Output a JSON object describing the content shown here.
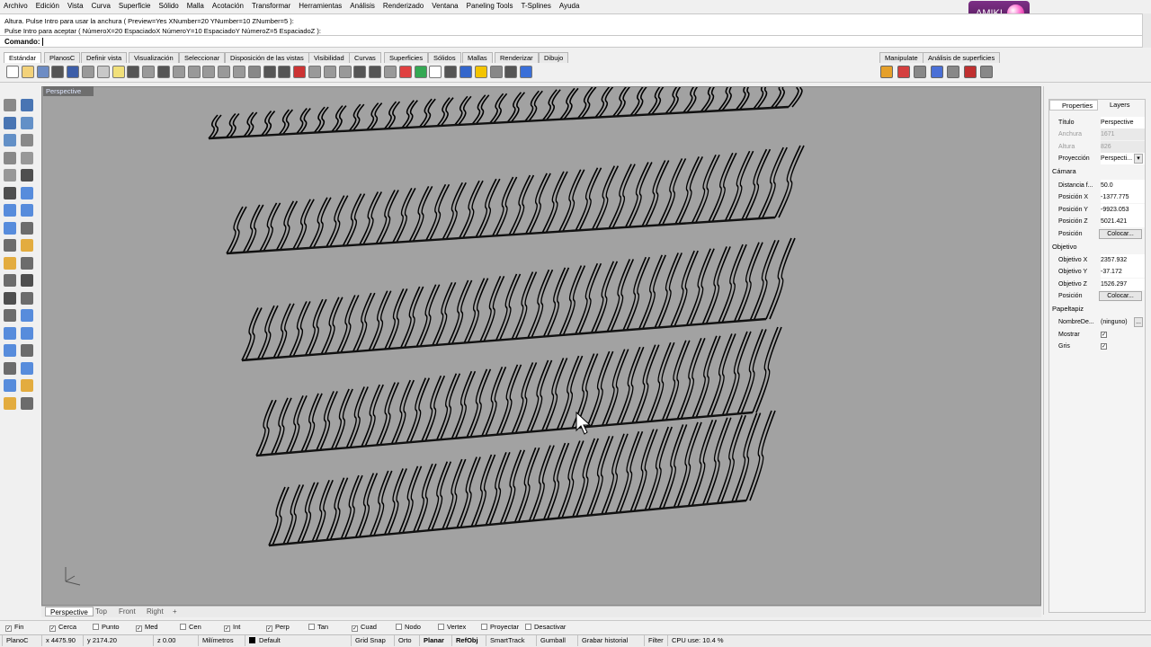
{
  "menu": [
    "Archivo",
    "Edición",
    "Vista",
    "Curva",
    "Superficie",
    "Sólido",
    "Malla",
    "Acotación",
    "Transformar",
    "Herramientas",
    "Análisis",
    "Renderizado",
    "Ventana",
    "Paneling Tools",
    "T-Splines",
    "Ayuda"
  ],
  "logo_text": "AMIKI",
  "command_history": [
    "Altura. Pulse Intro para usar la anchura ( Preview=Yes  XNumber=20  YNumber=10  ZNumber=5 ):",
    "Pulse Intro para aceptar ( NúmeroX=20  EspaciadoX  NúmeroY=10  EspaciadoY  NúmeroZ=5  EspaciadoZ ):"
  ],
  "command_label": "Comando:",
  "toolbar_tabs": [
    "Estándar",
    "PlanosC",
    "Definir vista",
    "Visualización",
    "Seleccionar",
    "Disposición de las vistas",
    "Visibilidad",
    "Curvas",
    "Superficies",
    "Sólidos",
    "Mallas",
    "Renderizar",
    "Dibujo"
  ],
  "right_toolbar_tabs": [
    "Manipulate",
    "Análisis de superficies"
  ],
  "viewport": {
    "label": "Perspective",
    "tabs": [
      "Perspective",
      "Top",
      "Front",
      "Right"
    ],
    "background": "#a2a2a2"
  },
  "properties": {
    "tab_properties": "Properties",
    "tab_layers": "Layers",
    "rows_top": [
      {
        "k": "Título",
        "v": "Perspective"
      },
      {
        "k": "Anchura",
        "v": "1671"
      },
      {
        "k": "Altura",
        "v": "826"
      },
      {
        "k": "Proyección",
        "v": "Perspecti..."
      }
    ],
    "section_camera": "Cámara",
    "rows_camera": [
      {
        "k": "Distancia f...",
        "v": "50.0"
      },
      {
        "k": "Posición X",
        "v": "-1377.775"
      },
      {
        "k": "Posición Y",
        "v": "-9923.053"
      },
      {
        "k": "Posición Z",
        "v": "5021.421"
      }
    ],
    "camera_pos_label": "Posición",
    "place_button": "Colocar...",
    "section_target": "Objetivo",
    "rows_target": [
      {
        "k": "Objetivo X",
        "v": "2357.932"
      },
      {
        "k": "Objetivo Y",
        "v": "-37.172"
      },
      {
        "k": "Objetivo Z",
        "v": "1526.297"
      }
    ],
    "target_pos_label": "Posición",
    "section_wallpaper": "Papeltapiz",
    "wallpaper_name_label": "NombreDe...",
    "wallpaper_name_value": "(ninguno)",
    "wallpaper_browse": "...",
    "show_label": "Mostrar",
    "gray_label": "Gris",
    "check_mark": "✓"
  },
  "osnaps": [
    {
      "label": "Fin",
      "checked": true
    },
    {
      "label": "Cerca",
      "checked": true
    },
    {
      "label": "Punto",
      "checked": false
    },
    {
      "label": "Med",
      "checked": true
    },
    {
      "label": "Cen",
      "checked": false
    },
    {
      "label": "Int",
      "checked": true
    },
    {
      "label": "Perp",
      "checked": true
    },
    {
      "label": "Tan",
      "checked": false
    },
    {
      "label": "Cuad",
      "checked": true
    },
    {
      "label": "Nodo",
      "checked": false
    },
    {
      "label": "Vertex",
      "checked": false
    },
    {
      "label": "Proyectar",
      "checked": false
    },
    {
      "label": "Desactivar",
      "checked": false
    }
  ],
  "status": {
    "cplane": "PlanoC",
    "x": "x 4475.90",
    "y": "y 2174.20",
    "z": "z 0.00",
    "units": "Milímetros",
    "layer": "Default",
    "grid_snap": "Grid Snap",
    "ortho": "Orto",
    "planar": "Planar",
    "osnap": "RefObj",
    "smarttrack": "SmartTrack",
    "gumball": "Gumball",
    "history": "Grabar historial",
    "filter": "Filter",
    "cpu": "CPU use: 10.4 %"
  },
  "icons": {
    "cursor": "arrow-cursor-icon",
    "axis": "world-axis-icon"
  }
}
